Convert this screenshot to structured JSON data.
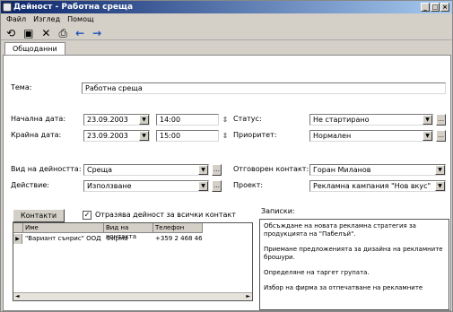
{
  "window": {
    "title": "Дейност - Работна среща"
  },
  "menu": [
    "Файл",
    "Изглед",
    "Помощ"
  ],
  "tab_label": "Общоданни",
  "form": {
    "subject_label": "Тема:",
    "subject_value": "Работна среща",
    "start_label": "Начална дата:",
    "start_date": "23.09.2003",
    "start_time": "14:00",
    "end_label": "Крайна дата:",
    "end_date": "23.09.2003",
    "end_time": "15:00",
    "status_label": "Статус:",
    "status_value": "Не стартирано",
    "priority_label": "Приоритет:",
    "priority_value": "Нормален",
    "type_label": "Вид на дейността:",
    "type_value": "Среща",
    "action_label": "Действие:",
    "action_value": "Използване",
    "owner_label": "Отговорен контакт:",
    "owner_value": "Горан Миланов",
    "project_label": "Проект:",
    "project_value": "Рекламна кампания \"Нов вкус\""
  },
  "contacts": {
    "button_label": "Контакти",
    "checkbox_label": "Отразява дейност за всички контакт",
    "columns": [
      "Име",
      "Вид на контакта",
      "Телефон"
    ],
    "rows": [
      {
        "name": "\"Вариант сънрис\" ООД",
        "kind": "Фирма",
        "phone": "+359 2 468 465"
      }
    ]
  },
  "notes": {
    "label": "Записки:",
    "paragraphs": [
      "Обсъждане на новата рекламна стратегия за продукцията на \"Пабелъй\".",
      "Приемане предложенията за дизайна на рекламните брошури.",
      "Определяне на таргет групата.",
      "Избор на фирма за отпечатване на рекламните"
    ]
  }
}
